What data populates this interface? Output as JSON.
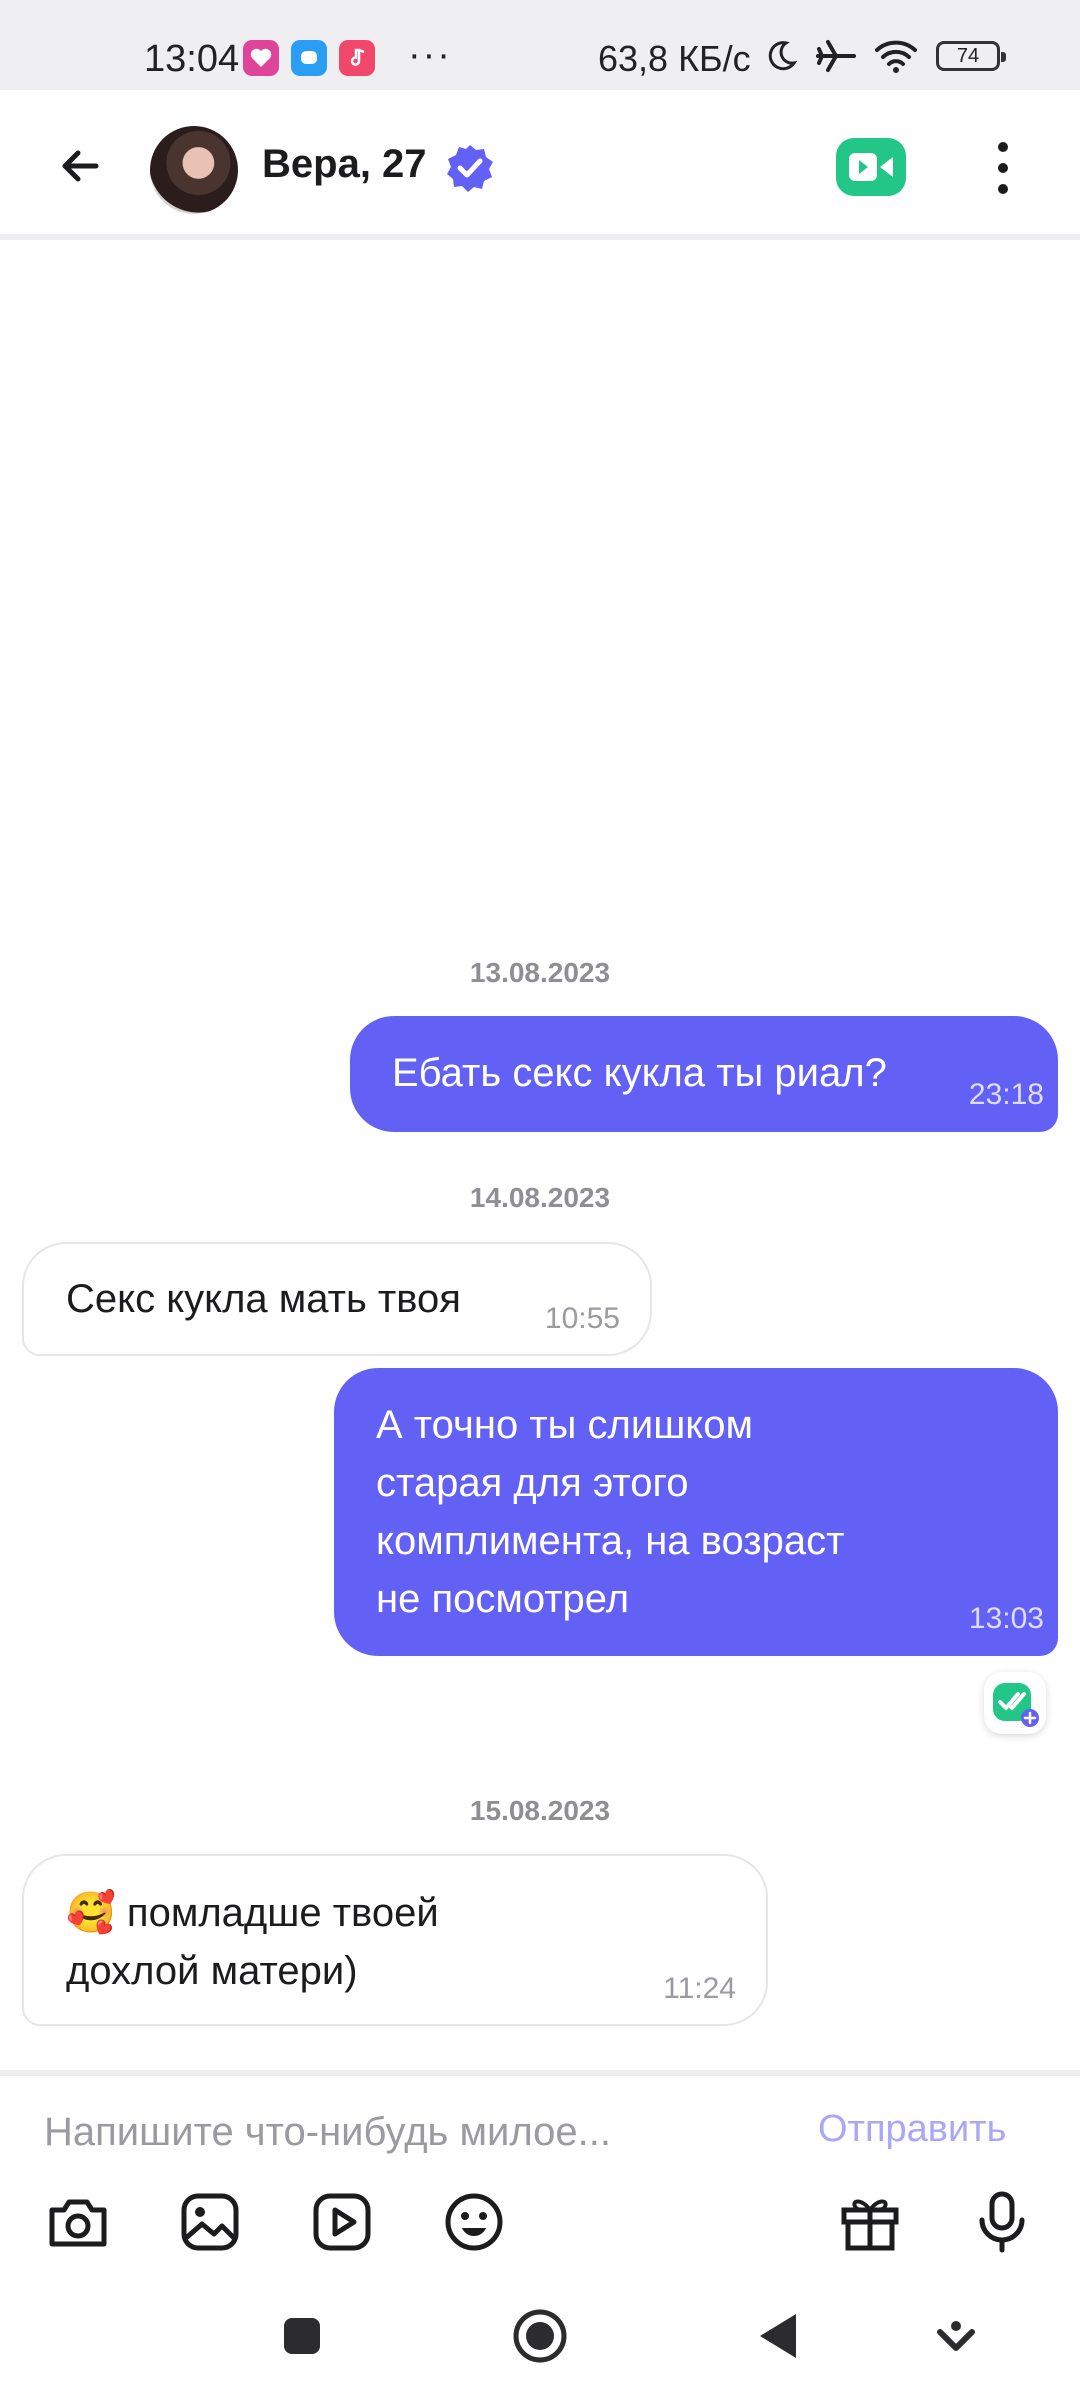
{
  "status_bar": {
    "time": "13:04",
    "more": "···",
    "network_speed": "63,8 КБ/с",
    "battery": "74"
  },
  "header": {
    "contact_name": "Вера, 27",
    "verified_icon": "check-badge-icon",
    "video_icon": "video-camera-icon",
    "accent_color": "#6360f5",
    "video_color": "#22c787"
  },
  "messages": [
    {
      "date": "13.08.2023"
    },
    {
      "direction": "out",
      "text": "Ебать секс кукла ты риал?",
      "time": "23:18"
    },
    {
      "date": "14.08.2023"
    },
    {
      "direction": "in",
      "text": "Секс кукла мать твоя",
      "time": "10:55"
    },
    {
      "direction": "out",
      "text": "А точно ты слишком\nстарая для этого\nкомплимента, на возраст\nне посмотрел",
      "time": "13:03"
    },
    {
      "date": "15.08.2023"
    },
    {
      "direction": "in",
      "text": "🥰 помладше твоей\nдохлой матери)",
      "time": "11:24"
    }
  ],
  "composer": {
    "placeholder": "Напишите что-нибудь милое...",
    "send_label": "Отправить",
    "tools": [
      "camera-icon",
      "gallery-icon",
      "play-icon",
      "emoji-icon",
      "gift-icon",
      "microphone-icon"
    ]
  },
  "nav": [
    "recent-apps-icon",
    "home-icon",
    "back-triangle-icon",
    "assistant-icon"
  ]
}
